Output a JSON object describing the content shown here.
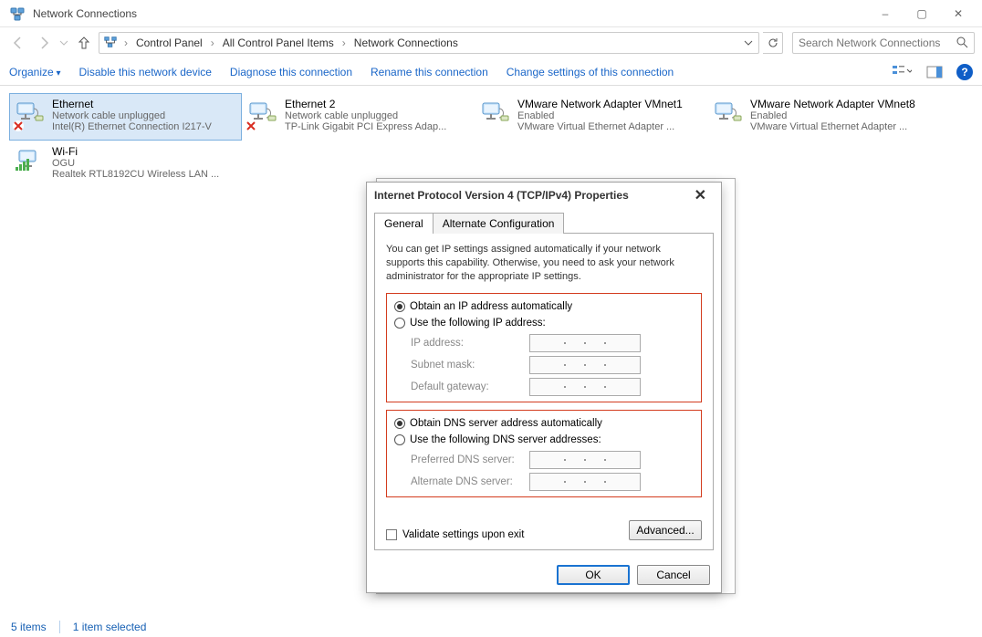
{
  "window": {
    "title": "Network Connections",
    "minimize_icon": "–",
    "maximize_icon": "▢",
    "close_icon": "✕"
  },
  "breadcrumbs": [
    "Control Panel",
    "All Control Panel Items",
    "Network Connections"
  ],
  "search": {
    "placeholder": "Search Network Connections"
  },
  "toolbar": {
    "organize": "Organize",
    "disable": "Disable this network device",
    "diagnose": "Diagnose this connection",
    "rename": "Rename this connection",
    "change": "Change settings of this connection"
  },
  "adapters": [
    {
      "name": "Ethernet",
      "status": "Network cable unplugged",
      "device": "Intel(R) Ethernet Connection I217-V",
      "selected": true,
      "disconnected": true,
      "type": "wired"
    },
    {
      "name": "Ethernet 2",
      "status": "Network cable unplugged",
      "device": "TP-Link Gigabit PCI Express Adap...",
      "selected": false,
      "disconnected": true,
      "type": "wired"
    },
    {
      "name": "VMware Network Adapter VMnet1",
      "status": "Enabled",
      "device": "VMware Virtual Ethernet Adapter ...",
      "selected": false,
      "disconnected": false,
      "type": "wired"
    },
    {
      "name": "VMware Network Adapter VMnet8",
      "status": "Enabled",
      "device": "VMware Virtual Ethernet Adapter ...",
      "selected": false,
      "disconnected": false,
      "type": "wired"
    },
    {
      "name": "Wi-Fi",
      "status": "OGU",
      "device": "Realtek RTL8192CU Wireless LAN ...",
      "selected": false,
      "disconnected": false,
      "type": "wifi"
    }
  ],
  "statusbar": {
    "items": "5 items",
    "selected": "1 item selected"
  },
  "dialog": {
    "title": "Internet Protocol Version 4 (TCP/IPv4) Properties",
    "tabs": [
      "General",
      "Alternate Configuration"
    ],
    "intro": "You can get IP settings assigned automatically if your network supports this capability. Otherwise, you need to ask your network administrator for the appropriate IP settings.",
    "ip": {
      "auto": "Obtain an IP address automatically",
      "manual": "Use the following IP address:",
      "fields": {
        "ip": "IP address:",
        "mask": "Subnet mask:",
        "gw": "Default gateway:"
      }
    },
    "dns": {
      "auto": "Obtain DNS server address automatically",
      "manual": "Use the following DNS server addresses:",
      "fields": {
        "pref": "Preferred DNS server:",
        "alt": "Alternate DNS server:"
      }
    },
    "validate": "Validate settings upon exit",
    "advanced": "Advanced...",
    "ok": "OK",
    "cancel": "Cancel"
  }
}
